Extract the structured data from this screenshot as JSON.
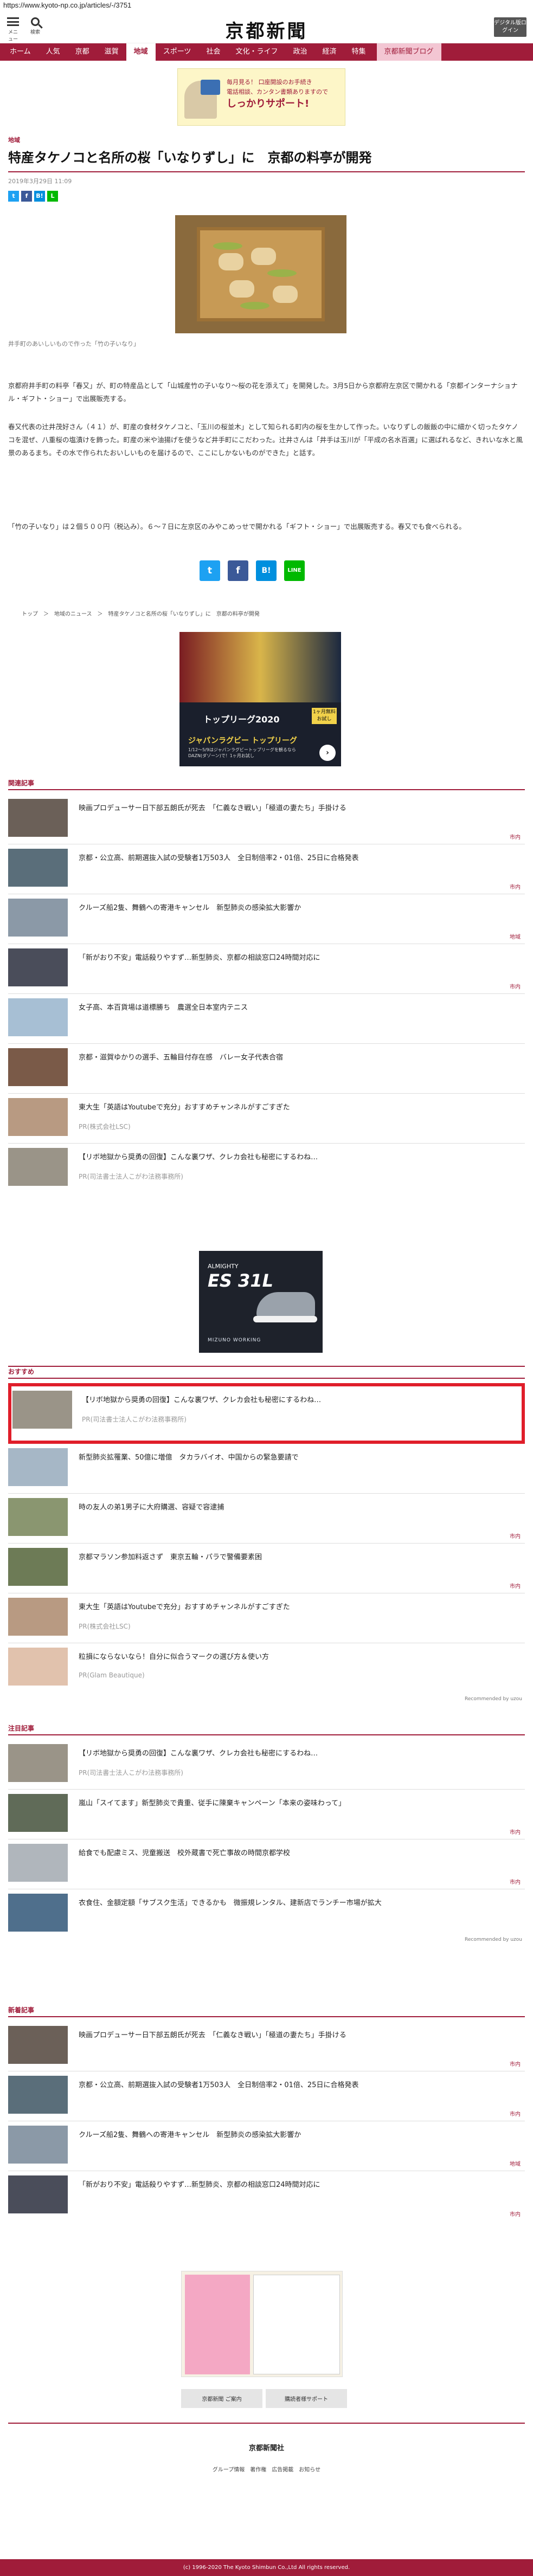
{
  "url": "https://www.kyoto-np.co.jp/articles/-/3751",
  "header": {
    "menu_label": "メニュー",
    "search_label": "検索",
    "logo": "京都新聞",
    "digital_label": "デジタル版ログイン"
  },
  "nav": {
    "items": [
      {
        "label": "ホーム"
      },
      {
        "label": "人気"
      },
      {
        "label": "京都"
      },
      {
        "label": "滋賀"
      },
      {
        "label": "地域"
      },
      {
        "label": "スポーツ"
      },
      {
        "label": "社会"
      },
      {
        "label": "文化・ライフ"
      },
      {
        "label": "政治"
      },
      {
        "label": "経済"
      },
      {
        "label": "特集"
      },
      {
        "label": "京都新聞ブログ"
      }
    ],
    "active_index": 4
  },
  "top_ad": {
    "line1": "毎月見る！ 口座開設のお手続き",
    "line2": "電話相談、カンタン書類ありますので",
    "line3": "しっかりサポート!"
  },
  "article": {
    "section": "地域",
    "title": "特産タケノコと名所の桜「いなりずし」に　京都の料亭が開発",
    "date": "2019年3月29日 11:09",
    "photo_caption": "井手町のあいしいもので作った「竹の子いなり」",
    "paragraphs": [
      "京都府井手町の料亭「春又」が、町の特産品として「山城産竹の子いなり～桜の花を添えて」を開発した。3月5日から京都府左京区で開かれる「京都インターナショナル・ギフト・ショー」で出展販売する。",
      "春又代表の辻井茂好さん（４１）が、町産の食材タケノコと、「玉川の桜並木」として知られる町内の桜を生かして作った。いなりずしの飯飯の中に細かく切ったタケノコを混ぜ、八重桜の塩漬けを飾った。町産の米や油揚げを使うなど井手町にこだわった。辻井さんは「井手は玉川が「平成の名水百選」に選ばれるなど、きれいな水と風景のあるまち。その水で作られたおいしいものを届けるので、ここにしかないものができた」と話す。",
      "「竹の子いなり」は２個５００円（税込み）。６～７日に左京区のみやこめっせで開かれる「ギフト・ショー」で出展販売する。春又でも食べられる。"
    ],
    "share_buttons": [
      "t",
      "f",
      "B!",
      "LINE"
    ],
    "small_share": [
      "t",
      "f",
      "B!",
      "L"
    ],
    "breadcrumb": "トップ　＞　地域のニュース　＞　特産タケノコと名所の桜「いなりずし」に　京都の料亭が開発"
  },
  "rugby_ad": {
    "title": "トップリーグ2020",
    "subtitle": "ジャパンラグビー トップリーグ",
    "desc": "1/12〜5/9はジャパンラグビートップリーグを観るならDAZN(ダゾーン)で！1ヶ月お試し",
    "tag": "1ヶ月無料お試し"
  },
  "related": {
    "heading": "関連記事",
    "items": [
      {
        "title": "映画プロデューサー日下部五朗氏が死去　「仁義なき戦い」「極道の妻たち」手掛ける",
        "category": "市内"
      },
      {
        "title": "京都・公立高、前期選抜入試の受験者1万503人　全日制倍率2・01倍、25日に合格発表",
        "category": "市内"
      },
      {
        "title": "クルーズ船2隻、舞鶴への寄港キャンセル　新型肺炎の感染拡大影響か",
        "category": "地域"
      },
      {
        "title": "「新がおり不安」電話殺りやすず…新型肺炎、京都の相談窓口24時間対応に",
        "category": "市内"
      },
      {
        "title": "女子高、本百貨場は道標勝ち　農選全日本室内テニス",
        "category": ""
      },
      {
        "title": "京都・滋賀ゆかりの選手、五輪目付存在感　バレー女子代表合宿",
        "category": ""
      },
      {
        "title": "東大生「英語はYoutubeで充分」おすすめチャンネルがすごすぎた",
        "pr": "PR(株式会社LSC)"
      },
      {
        "title": "【リボ地獄から奨勇の回復】こんな裏ワザ、クレカ会社も秘密にするわね…",
        "pr": "PR(司法書士法人こがわ法務事務所)"
      }
    ]
  },
  "shoe_ad": {
    "line1": "ALMIGHTY",
    "line2": "ES 31L",
    "brand": "MIZUNO WORKING"
  },
  "recommend": {
    "heading": "おすすめ",
    "items": [
      {
        "title": "【リボ地獄から奨勇の回復】こんな裏ワザ、クレカ会社も秘密にするわね…",
        "pr": "PR(司法書士法人こがわ法務事務所)"
      },
      {
        "title": "新型肺炎拡罹業、50億に増億　タカラバイオ、中国からの緊急要請で",
        "category": ""
      },
      {
        "title": "時の友人の弟1男子に大府購選、容疑で容逮捕",
        "category": "市内"
      },
      {
        "title": "京都マラソン参加料返さず　東京五輪・パラで警備要素困",
        "category": "市内"
      },
      {
        "title": "東大生「英語はYoutubeで充分」おすすめチャンネルがすごすぎた",
        "pr": "PR(株式会社LSC)"
      },
      {
        "title": "粒損にならないなら！自分に似合うマークの選び方＆使い方",
        "pr": "PR(Glam Beautique)"
      }
    ],
    "recommended_by": "Recommended by uzou"
  },
  "attention": {
    "heading": "注目記事",
    "items": [
      {
        "title": "【リボ地獄から奨勇の回復】こんな裏ワザ、クレカ会社も秘密にするわね…",
        "pr": "PR(司法書士法人こがわ法務事務所)"
      },
      {
        "title": "嵐山「スイてます」新型肺炎で貴重、従手に陳棄キャンペーン「本来の姿味わって」",
        "category": "市内"
      },
      {
        "title": "給食でも配慮ミス、児童搬送　校外蔵書で死亡事故の時間京都学校",
        "category": "市内"
      },
      {
        "title": "衣食住、金額定額「サブスク生活」できるかも　微振規レンタル、建新店でランチー市場が拡大",
        "category": ""
      }
    ],
    "recommended_by": "Recommended by uzou"
  },
  "latest": {
    "heading": "新着記事",
    "items": [
      {
        "title": "映画プロデューサー日下部五朗氏が死去　「仁義なき戦い」「極道の妻たち」手掛ける",
        "category": "市内"
      },
      {
        "title": "京都・公立高、前期選抜入試の受験者1万503人　全日制倍率2・01倍、25日に合格発表",
        "category": "市内"
      },
      {
        "title": "クルーズ船2隻、舞鶴への寄港キャンセル　新型肺炎の感染拡大影響か",
        "category": "地域"
      },
      {
        "title": "「新がおり不安」電話殺りやすず…新型肺炎、京都の相談窓口24時間対応に",
        "category": "市内"
      }
    ]
  },
  "footer": {
    "buttons": [
      "京都新聞 ご案内",
      "購読者様サポート"
    ],
    "logo": "京都新聞社",
    "links": "グループ情報　著作権　広告掲載　お知らせ",
    "copyright": "(c) 1996-2020 The Kyoto Shimbun Co.,Ltd All rights reserved."
  },
  "colors": {
    "brand": "#a01c3a",
    "highlight": "#e01e2a"
  }
}
